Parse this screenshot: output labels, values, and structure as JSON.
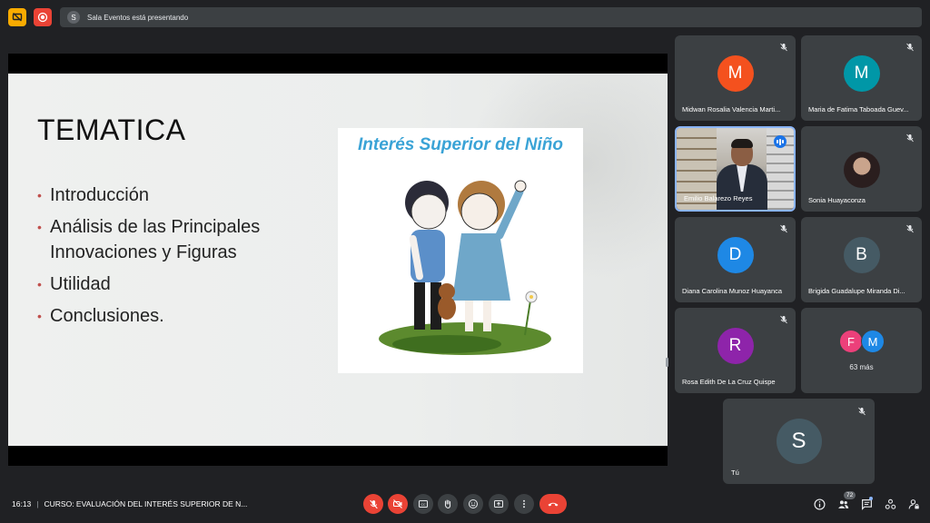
{
  "topbar": {
    "presenter_initial": "S",
    "presenting_text": "Sala Eventos está presentando"
  },
  "slide": {
    "title": "TEMATICA",
    "bullets": [
      "Introducción",
      "Análisis de las Principales Innovaciones y Figuras",
      "Utilidad",
      "Conclusiones."
    ],
    "image_title": "Interés Superior del Niño"
  },
  "participants": [
    {
      "initial": "M",
      "name": "Midwan Rosalia Valencia Marti...",
      "color": "#f4511e",
      "muted": true
    },
    {
      "initial": "M",
      "name": "Maria de Fatima Taboada Guev...",
      "color": "#0097a7",
      "muted": true
    },
    {
      "initial": "",
      "name": "Emilio Balarezo Reyes",
      "color": "",
      "muted": false,
      "speaking": true
    },
    {
      "initial": "",
      "name": "Sonia Huayaconza",
      "color": "",
      "muted": true
    },
    {
      "initial": "D",
      "name": "Diana Carolina Munoz Huayanca",
      "color": "#1e88e5",
      "muted": true
    },
    {
      "initial": "B",
      "name": "Brigida Guadalupe Miranda Di...",
      "color": "#455a64",
      "muted": true
    },
    {
      "initial": "R",
      "name": "Rosa Edith De La Cruz Quispe",
      "color": "#8e24aa",
      "muted": true
    }
  ],
  "more_tile": {
    "initials": [
      "F",
      "M"
    ],
    "colors": [
      "#ec407a",
      "#1e88e5"
    ],
    "label": "63 más"
  },
  "self_tile": {
    "initial": "S",
    "name": "Tú"
  },
  "bottombar": {
    "time": "16:13",
    "meeting_title": "CURSO: EVALUACIÓN DEL INTERÉS SUPERIOR DE N...",
    "people_count": "72"
  },
  "colors": {
    "background": "#202124",
    "tile": "#3c4043",
    "danger": "#ea4335",
    "speaking": "#1a73e8",
    "accent": "#8ab4f8"
  }
}
